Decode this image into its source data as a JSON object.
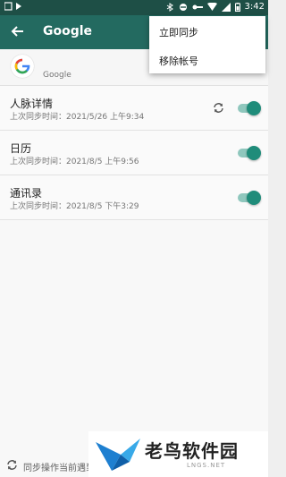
{
  "status_bar": {
    "time": "3:42"
  },
  "toolbar": {
    "title": "Google"
  },
  "account": {
    "name": "Google"
  },
  "sync_items": [
    {
      "title": "人脉详情",
      "subtitle": "上次同步时间：2021/5/26 上午9:34",
      "enabled": true,
      "syncing": true
    },
    {
      "title": "日历",
      "subtitle": "上次同步时间：2021/8/5 上午9:56",
      "enabled": true,
      "syncing": false
    },
    {
      "title": "通讯录",
      "subtitle": "上次同步时间：2021/8/5 下午3:29",
      "enabled": true,
      "syncing": false
    }
  ],
  "footer": {
    "text": "同步操作当前遇到"
  },
  "menu": {
    "items": [
      "立即同步",
      "移除帐号"
    ]
  },
  "watermark": {
    "text": "老鸟软件园",
    "sub": "LNGS.NET"
  },
  "colors": {
    "accent": "#1f8c7a",
    "toolbar": "#236a60",
    "status_bar": "#1e4f46"
  }
}
